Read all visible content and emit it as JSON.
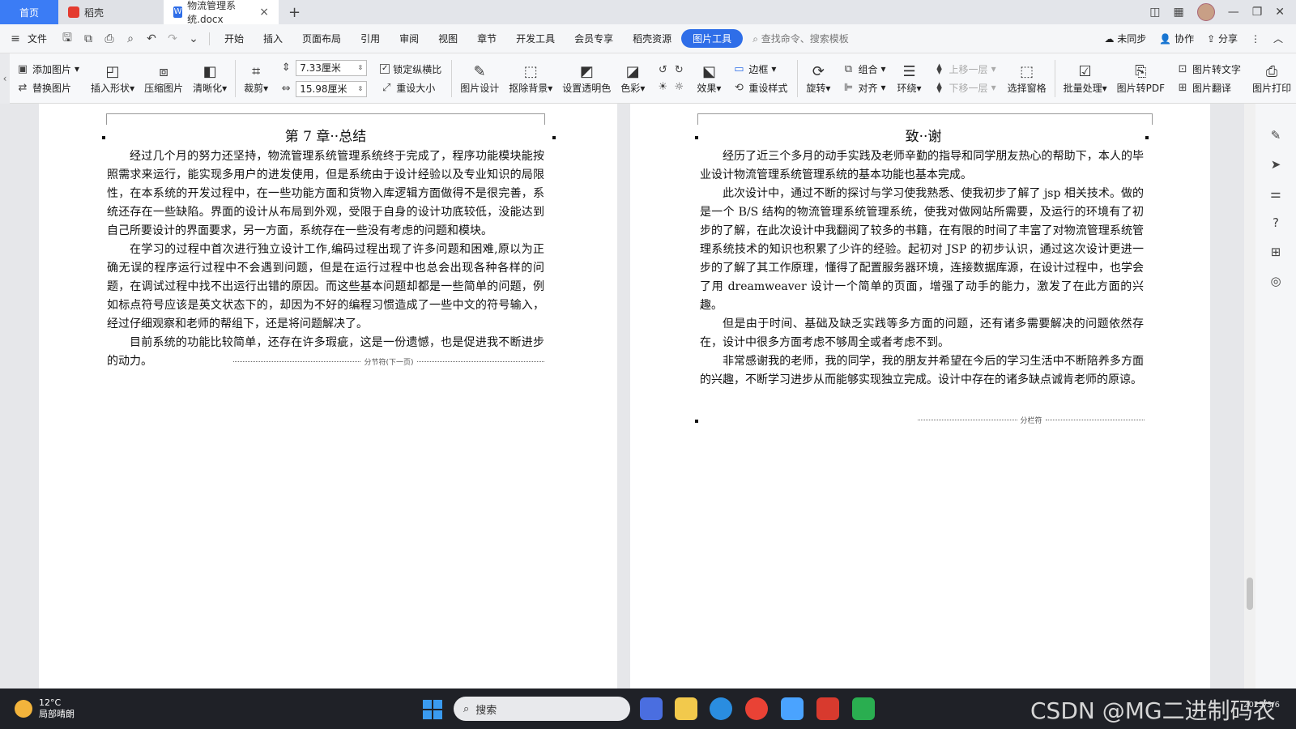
{
  "tabs": {
    "home": "首页",
    "daoke": "稻壳",
    "doc": "物流管理系统.docx",
    "new_tab": "+"
  },
  "menu": {
    "file": "文件",
    "items": [
      "开始",
      "插入",
      "页面布局",
      "引用",
      "审阅",
      "视图",
      "章节",
      "开发工具",
      "会员专享",
      "稻壳资源"
    ],
    "active": "图片工具",
    "search_placeholder": "查找命令、搜索模板",
    "sync": "未同步",
    "collab": "协作",
    "share": "分享"
  },
  "toolbar": {
    "add_image": "添加图片",
    "replace_image": "替换图片",
    "insert_shape": "插入形状",
    "compress": "压缩图片",
    "sharpen": "清晰化",
    "crop": "裁剪",
    "width": "7.33厘米",
    "height": "15.98厘米",
    "lock_ratio": "锁定纵横比",
    "reset_size": "重设大小",
    "image_design": "图片设计",
    "remove_bg": "抠除背景",
    "set_transparent": "设置透明色",
    "color": "色彩",
    "effects": "效果",
    "border": "边框",
    "reset_style": "重设样式",
    "rotate": "旋转",
    "group": "组合",
    "align": "对齐",
    "wrap": "环绕",
    "bring_forward": "上移一层",
    "send_backward": "下移一层",
    "select_pane": "选择窗格",
    "batch": "批量处理",
    "to_pdf": "图片转PDF",
    "to_text": "图片转文字",
    "translate": "图片翻译",
    "print": "图片打印"
  },
  "page1": {
    "heading": "第 7 章··总结",
    "paragraphs": [
      "经过几个月的努力还坚持，物流管理系统管理系统终于完成了，程序功能模块能按照需求来运行，能实现多用户的进发使用，但是系统由于设计经验以及专业知识的局限性，在本系统的开发过程中，在一些功能方面和货物入库逻辑方面做得不是很完善，系统还存在一些缺陷。界面的设计从布局到外观，受限于自身的设计功底较低，没能达到自己所要设计的界面要求，另一方面，系统存在一些没有考虑的问题和模块。",
      "在学习的过程中首次进行独立设计工作,编码过程出现了许多问题和困难,原以为正确无误的程序运行过程中不会遇到问题，但是在运行过程中也总会出现各种各样的问题，在调试过程中找不出运行出错的原因。而这些基本问题却都是一些简单的问题，例如标点符号应该是英文状态下的，却因为不好的编程习惯造成了一些中文的符号输入，经过仔细观察和老师的帮组下，还是将问题解决了。",
      "目前系统的功能比较简单，还存在许多瑕疵，这是一份遗憾，也是促进我不断进步的动力。"
    ],
    "section_break": "分节符(下一页)"
  },
  "page2": {
    "heading": "致··谢",
    "paragraphs": [
      "经历了近三个多月的动手实践及老师辛勤的指导和同学朋友热心的帮助下，本人的毕业设计物流管理系统管理系统的基本功能也基本完成。",
      "此次设计中，通过不断的探讨与学习使我熟悉、使我初步了解了 jsp 相关技术。做的是一个 B/S 结构的物流管理系统管理系统，使我对做网站所需要，及运行的环境有了初步的了解，在此次设计中我翻阅了较多的书籍，在有限的时间了丰富了对物流管理系统管理系统技术的知识也积累了少许的经验。起初对 JSP 的初步认识，通过这次设计更进一步的了解了其工作原理，懂得了配置服务器环境，连接数据库源，在设计过程中，也学会了用 dreamweaver 设计一个简单的页面，增强了动手的能力，激发了在此方面的兴趣。",
      "但是由于时间、基础及缺乏实践等多方面的问题，还有诸多需要解决的问题依然存在，设计中很多方面考虑不够周全或者考虑不到。",
      "非常感谢我的老师，我的同学，我的朋友并希望在今后的学习生活中不断陪养多方面的兴趣，不断学习进步从而能够实现独立完成。设计中存在的诸多缺点诚肯老师的原谅。"
    ],
    "page_break": "分栏符"
  },
  "taskbar": {
    "temperature": "12°C",
    "weather": "局部晴朗",
    "search": "搜索",
    "date": "2025/3/6"
  },
  "watermark": "CSDN @MG二进制码农"
}
